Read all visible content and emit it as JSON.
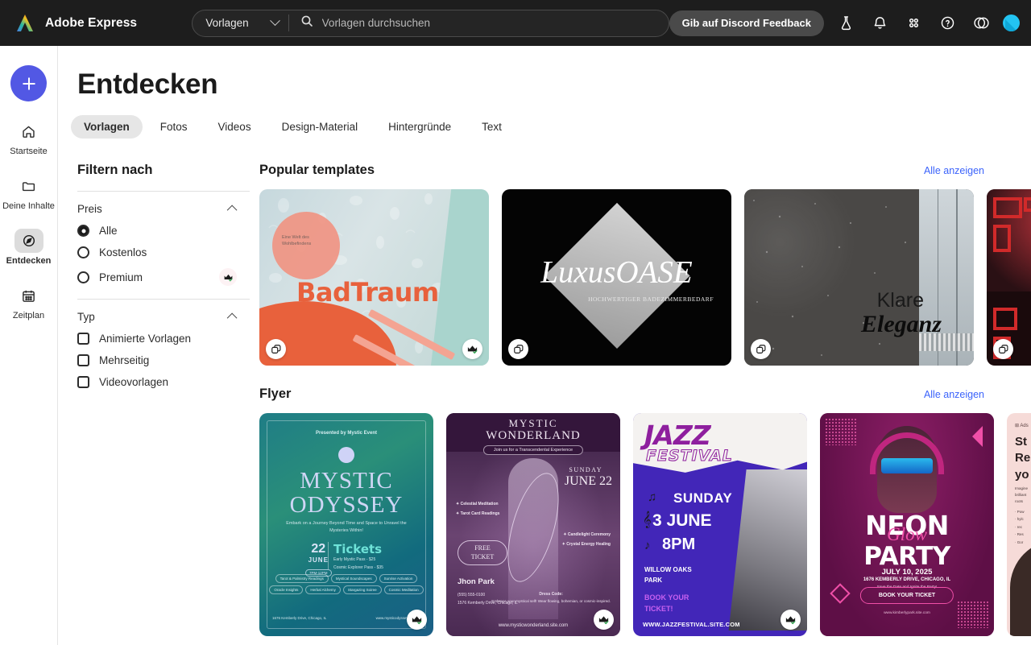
{
  "topbar": {
    "brand": "Adobe Express",
    "logo_icon": "adobe-express-logo",
    "category_label": "Vorlagen",
    "category_chevron_icon": "chevron-down-icon",
    "search_icon": "search-icon",
    "search_placeholder": "Vorlagen durchsuchen",
    "search_value": "",
    "feedback_button": "Gib auf Discord Feedback",
    "icons": [
      {
        "name": "flask-icon",
        "title": "Experimente"
      },
      {
        "name": "bell-icon",
        "title": "Benachrichtigungen"
      },
      {
        "name": "apps-grid-icon",
        "title": "Apps"
      },
      {
        "name": "help-icon",
        "title": "Hilfe"
      },
      {
        "name": "creative-cloud-icon",
        "title": "Creative Cloud"
      }
    ],
    "avatar_icon": "user-avatar",
    "bg_color": "#1d1d1d"
  },
  "sidebar": {
    "new_button_icon": "plus-icon",
    "items": [
      {
        "label": "Startseite",
        "icon": "home-icon",
        "active": false
      },
      {
        "label": "Deine Inhalte",
        "icon": "folder-icon",
        "active": false
      },
      {
        "label": "Entdecken",
        "icon": "compass-icon",
        "active": true
      },
      {
        "label": "Zeitplan",
        "icon": "calendar-icon",
        "active": false
      }
    ]
  },
  "page": {
    "title": "Entdecken",
    "tabs": [
      {
        "label": "Vorlagen",
        "active": true
      },
      {
        "label": "Fotos",
        "active": false
      },
      {
        "label": "Videos",
        "active": false
      },
      {
        "label": "Design-Material",
        "active": false
      },
      {
        "label": "Hintergründe",
        "active": false
      },
      {
        "label": "Text",
        "active": false
      }
    ]
  },
  "filters": {
    "title": "Filtern nach",
    "price": {
      "title": "Preis",
      "collapse_icon": "chevron-up-icon",
      "options": [
        {
          "label": "Alle",
          "selected": true,
          "premium": false
        },
        {
          "label": "Kostenlos",
          "selected": false,
          "premium": false
        },
        {
          "label": "Premium",
          "selected": false,
          "premium": true,
          "badge_icon": "crown-icon"
        }
      ]
    },
    "type": {
      "title": "Typ",
      "collapse_icon": "chevron-up-icon",
      "options": [
        {
          "label": "Animierte Vorlagen",
          "checked": false
        },
        {
          "label": "Mehrseitig",
          "checked": false
        },
        {
          "label": "Videovorlagen",
          "checked": false
        }
      ]
    }
  },
  "sections": [
    {
      "id": "popular",
      "title": "Popular templates",
      "link": "Alle anzeigen",
      "cards": [
        {
          "id": "badtraum",
          "title": "BadTraum",
          "subtitle": "Eine Welt des Wohlbefindens",
          "badge_left": "multipage-icon",
          "badge_right": "premium-crown-icon"
        },
        {
          "id": "luxusoase",
          "title": "LuxusOASE",
          "subtitle": "HOCHWERTIGER BADEZIMMERBEDARF",
          "badge_left": "multipage-icon",
          "badge_right": null
        },
        {
          "id": "klare-eleganz",
          "title_line1": "Klare",
          "title_line2": "Eleganz",
          "badge_left": "multipage-icon",
          "badge_right": null
        },
        {
          "id": "red-pattern",
          "title": "",
          "badge_left": "multipage-icon",
          "badge_right": null
        }
      ]
    },
    {
      "id": "flyer",
      "title": "Flyer",
      "link": "Alle anzeigen",
      "cards": [
        {
          "id": "mystic-odyssey",
          "presented": "Presented by Mystic Event",
          "title_line1": "MYSTIC",
          "title_line2": "ODYSSEY",
          "tagline": "Embark on a Journey Beyond Time and Space to Unravel the Mysteries Within!",
          "date_day": "22",
          "date_month": "JUNE",
          "date_time": "7PM-12PM",
          "tickets_title": "Tickets",
          "ticket_line1": "Early Mystic Pass - $25",
          "ticket_line2": "Cosmic Explorer Pass - $35",
          "pills": [
            "Tarot & Palmistry Readings",
            "Mystical Soundscapes",
            "Sunrise Activation",
            "Oracle Insights",
            "Herbal Alchemy",
            "Stargazing Soiree",
            "Cosmic Meditation"
          ],
          "address": "1676 Kemberly Drive, Chicago, IL",
          "website": "www.mysticodyssey.com",
          "badge_right": "premium-crown-icon"
        },
        {
          "id": "mystic-wonderland",
          "title_line1": "MYSTIC",
          "title_line2": "WONDERLAND",
          "join": "Join us for a Transcendental Experience",
          "day_label": "SUNDAY",
          "date": "JUNE 22",
          "bullets_left": [
            "Celestial Meditation",
            "Tarot Card Readings"
          ],
          "bullets_right": [
            "Candlelight Ceremony",
            "Crystal Energy Healing"
          ],
          "free_line1": "FREE",
          "free_line2": "TICKET",
          "contact_name": "Jhon Park",
          "contact_phone": "(555) 555-0100",
          "contact_address": "1576 Kemberly Drive, Chicago, IL",
          "dress_code_title": "Dress Code:",
          "dress_code_text": "Embrace your mystical self! Wear flowing, bohemian, or cosmic-inspired.",
          "website": "www.mysticwonderland.site.com",
          "badge_right": "premium-crown-icon"
        },
        {
          "id": "jazz-festival",
          "title_line1": "JAZZ",
          "title_line2": "FESTIVAL",
          "day_label": "SUNDAY",
          "date": "3 JUNE",
          "time": "8PM",
          "venue_line1": "WILLOW OAKS",
          "venue_line2": "PARK",
          "cta_line1": "BOOK YOUR",
          "cta_line2": "TICKET!",
          "website": "WWW.JAZZFESTIVAL.SITE.COM",
          "badge_right": "premium-crown-icon"
        },
        {
          "id": "neon-glow-party",
          "title_line1": "NEON",
          "title_line2": "Glow",
          "title_line3": "PARTY",
          "date": "JULY 10, 2025",
          "address": "1676 KEMBERLY DRIVE, CHICAGO, IL",
          "tagline": "Save the Date and Ignite the Party!",
          "cta": "BOOK YOUR TICKET",
          "website": "www.kimberlypark.site.com",
          "badge_right": null
        },
        {
          "id": "pink-flyer",
          "label": "Ads",
          "title_line1": "St",
          "title_line2": "Re",
          "title_line3": "yo",
          "badge_right": "multipage-icon"
        }
      ]
    }
  ],
  "colors": {
    "accent": "#5258e4",
    "link": "#3b63fb",
    "topbar_bg": "#1d1d1d",
    "avatar": "#23c4f2"
  }
}
